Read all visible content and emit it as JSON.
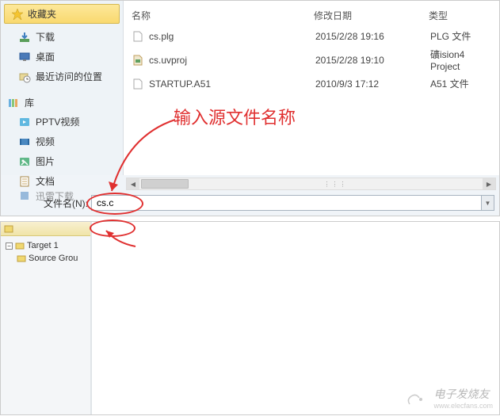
{
  "sidebar": {
    "favorites_label": "收藏夹",
    "items": [
      {
        "label": "下载"
      },
      {
        "label": "桌面"
      },
      {
        "label": "最近访问的位置"
      }
    ],
    "library_label": "库",
    "lib_items": [
      {
        "label": "PPTV视频"
      },
      {
        "label": "视频"
      },
      {
        "label": "图片"
      },
      {
        "label": "文档"
      },
      {
        "label": "迅雷下载"
      }
    ]
  },
  "file_list": {
    "columns": {
      "name": "名称",
      "date": "修改日期",
      "type": "类型"
    },
    "files": [
      {
        "name": "cs.plg",
        "date": "2015/2/28 19:16",
        "type": "PLG 文件"
      },
      {
        "name": "cs.uvproj",
        "date": "2015/2/28 19:10",
        "type": "礦ision4 Project"
      },
      {
        "name": "STARTUP.A51",
        "date": "2010/9/3 17:12",
        "type": "A51 文件"
      }
    ]
  },
  "filename_row": {
    "label": "文件名(N):",
    "value": "cs.c"
  },
  "annotation": {
    "text": "输入源文件名称"
  },
  "tree": {
    "root": "Target 1",
    "child": "Source Grou"
  },
  "watermark": {
    "brand": "电子发烧友",
    "url": "www.elecfans.com"
  }
}
